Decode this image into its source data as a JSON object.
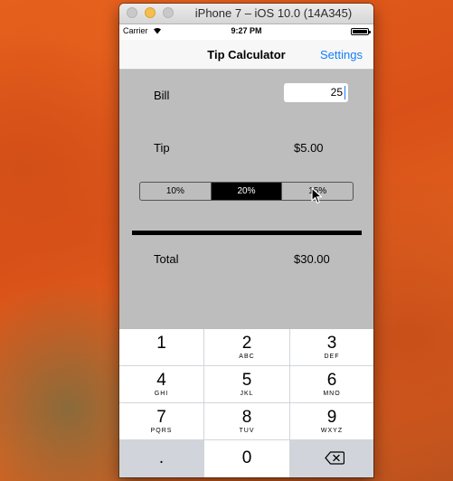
{
  "window": {
    "title": "iPhone 7 – iOS 10.0 (14A345)"
  },
  "status_bar": {
    "carrier": "Carrier",
    "time": "9:27 PM"
  },
  "nav": {
    "title": "Tip Calculator",
    "settings_label": "Settings"
  },
  "bill": {
    "label": "Bill",
    "value": "25"
  },
  "tip": {
    "label": "Tip",
    "amount": "$5.00"
  },
  "tip_options": {
    "items": [
      "10%",
      "20%",
      "15%"
    ],
    "selected_index": 1
  },
  "total": {
    "label": "Total",
    "amount": "$30.00"
  },
  "keypad": {
    "keys": [
      {
        "digit": "1",
        "letters": ""
      },
      {
        "digit": "2",
        "letters": "ABC"
      },
      {
        "digit": "3",
        "letters": "DEF"
      },
      {
        "digit": "4",
        "letters": "GHI"
      },
      {
        "digit": "5",
        "letters": "JKL"
      },
      {
        "digit": "6",
        "letters": "MNO"
      },
      {
        "digit": "7",
        "letters": "PQRS"
      },
      {
        "digit": "8",
        "letters": "TUV"
      },
      {
        "digit": "9",
        "letters": "WXYZ"
      }
    ],
    "dot": ".",
    "zero": "0"
  },
  "colors": {
    "accent": "#157efb",
    "content_bg": "#bdbdbd",
    "keypad_bg": "#d1d5db"
  }
}
